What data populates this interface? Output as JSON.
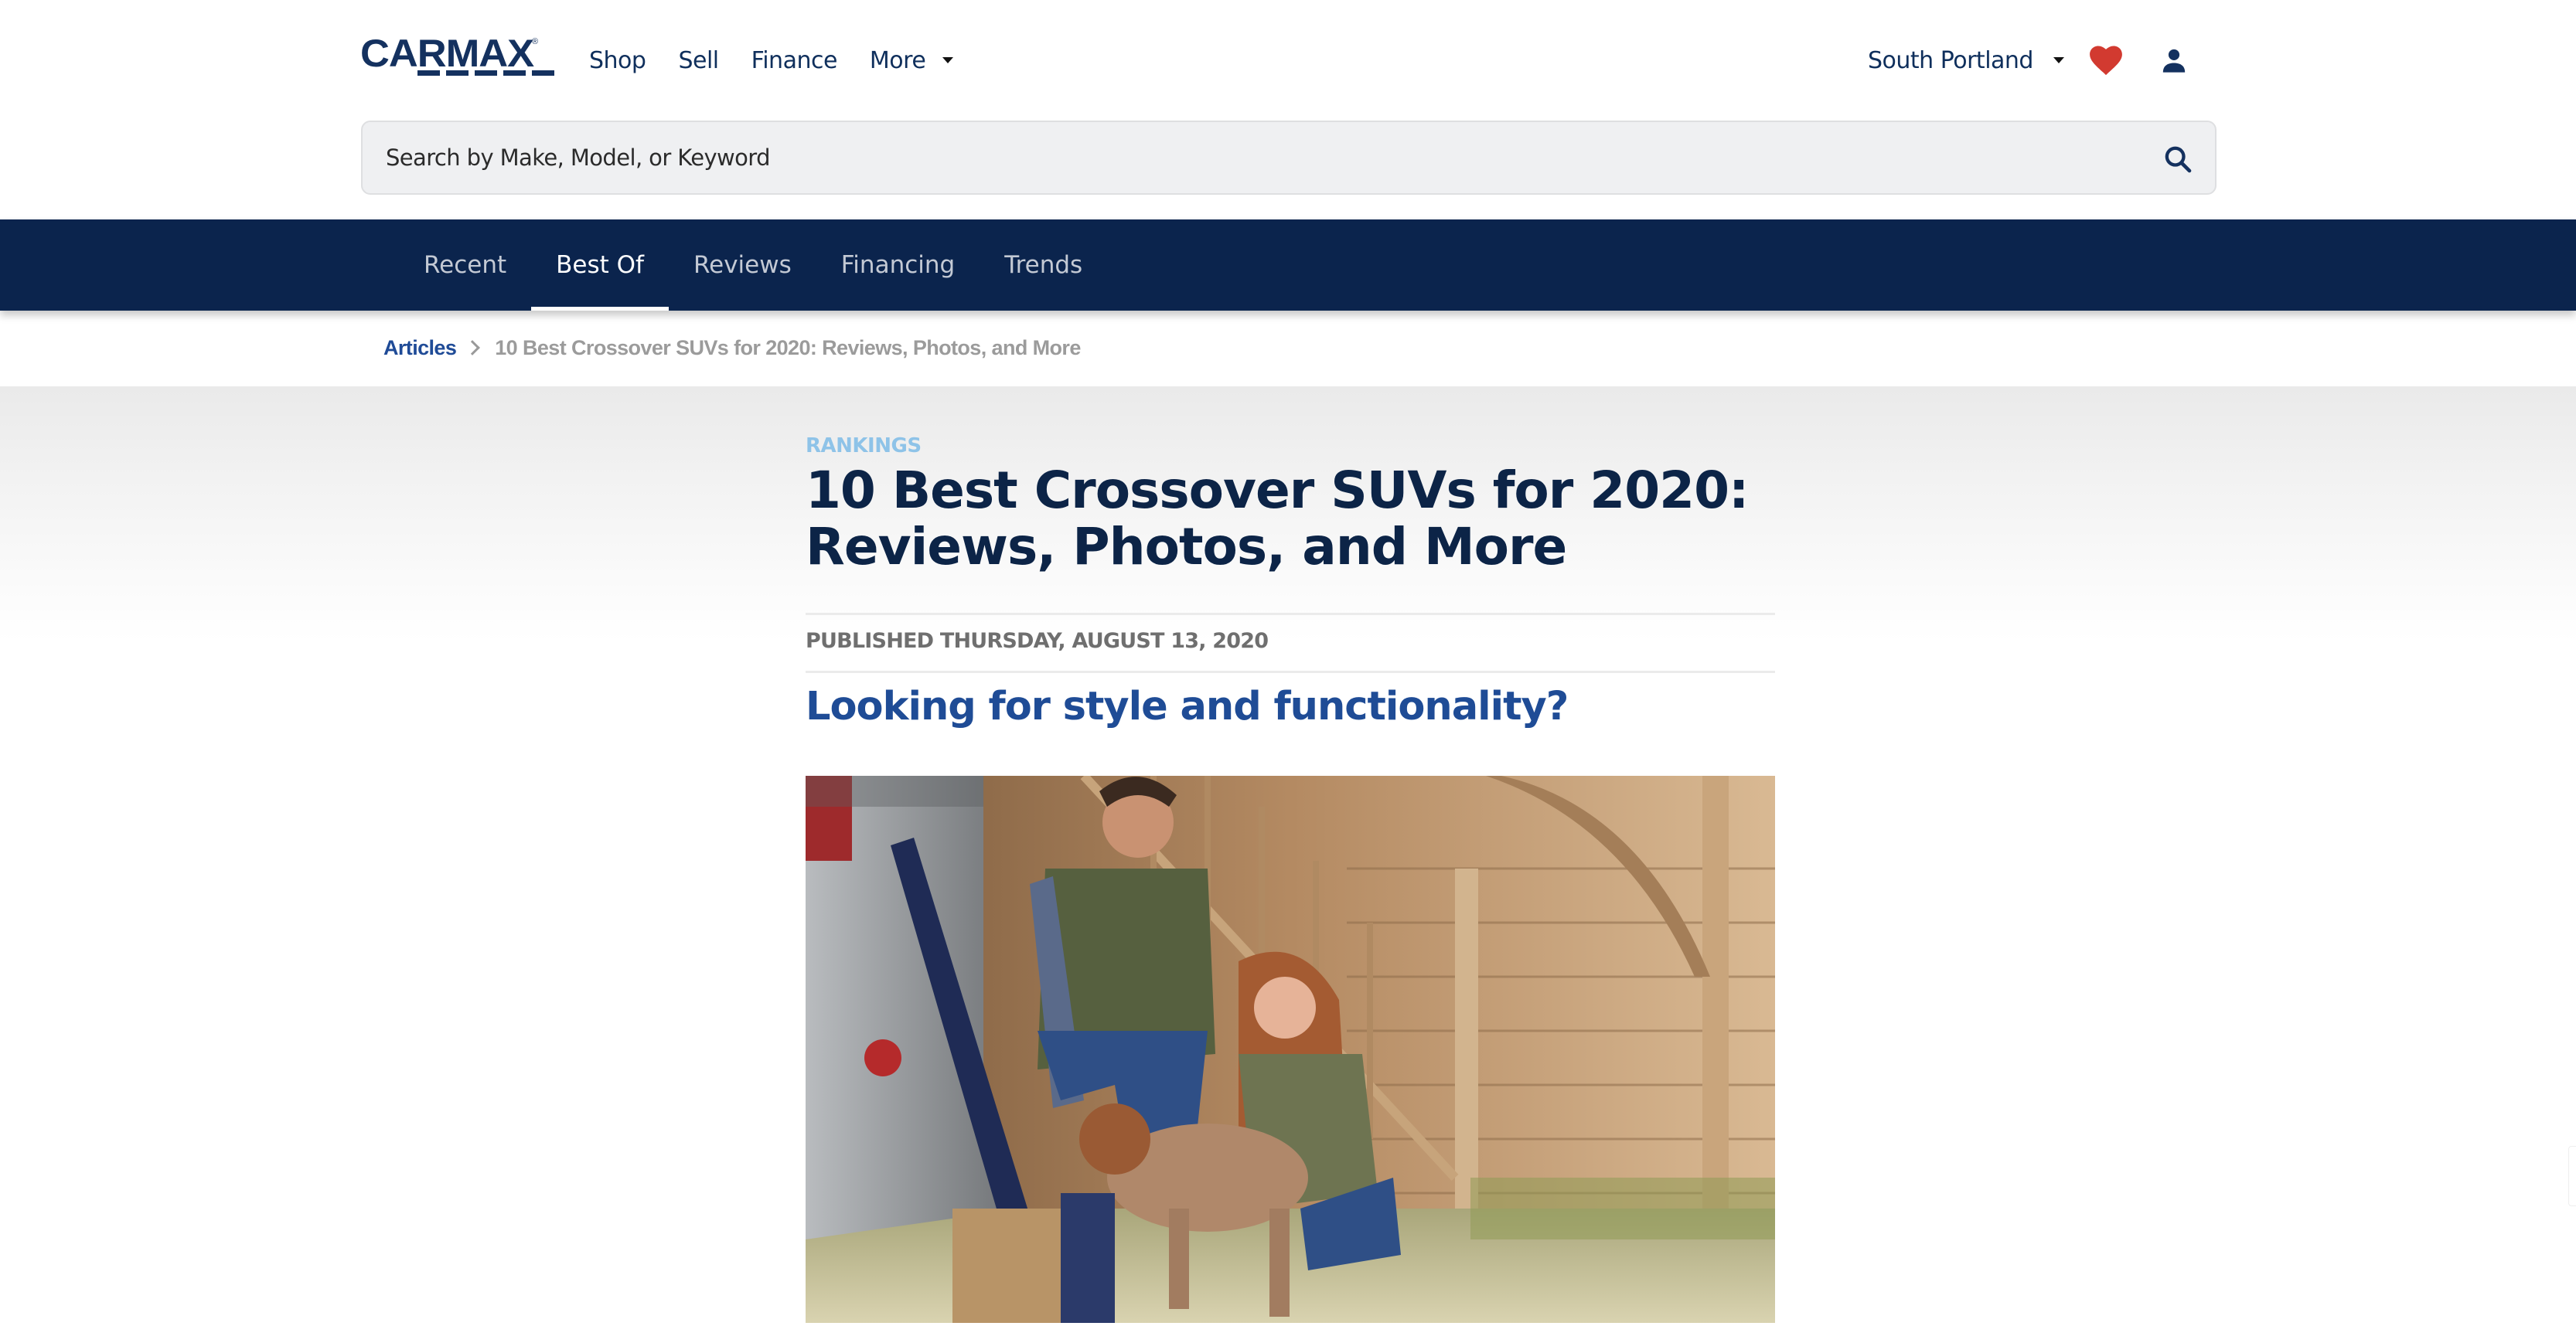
{
  "header": {
    "logo_text": "CARMAX",
    "logo_mark": "®",
    "nav": [
      {
        "label": "Shop"
      },
      {
        "label": "Sell"
      },
      {
        "label": "Finance"
      },
      {
        "label": "More"
      }
    ],
    "location": "South Portland",
    "icons": {
      "favorites": "heart-icon",
      "account": "user-icon",
      "search": "search-icon",
      "dropdown": "caret-down-icon"
    },
    "colors": {
      "brand_navy": "#14315f",
      "heart_red": "#d23a30"
    }
  },
  "search": {
    "placeholder": "Search by Make, Model, or Keyword",
    "value": ""
  },
  "subnav": {
    "items": [
      {
        "label": "Recent",
        "active": false
      },
      {
        "label": "Best Of",
        "active": true
      },
      {
        "label": "Reviews",
        "active": false
      },
      {
        "label": "Financing",
        "active": false
      },
      {
        "label": "Trends",
        "active": false
      }
    ],
    "background": "#0b244d"
  },
  "breadcrumb": {
    "root": "Articles",
    "current": "10 Best Crossover SUVs for 2020: Reviews, Photos, and More"
  },
  "article": {
    "category": "RANKINGS",
    "title_line1": "10 Best Crossover SUVs for 2020:",
    "title_line2": "Reviews, Photos, and More",
    "published": "PUBLISHED THURSDAY, AUGUST 13, 2020",
    "subheading": "Looking for style and functionality?",
    "hero_image_alt": "Couple petting a dog beside the open hatch of a silver crossover SUV in front of a wooden cabin"
  }
}
